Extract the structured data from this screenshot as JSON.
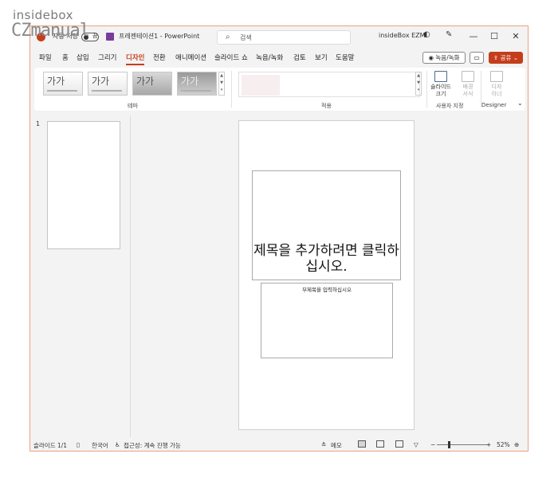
{
  "watermark": {
    "line1": "insidebox",
    "line2": "CZmanual"
  },
  "titlebar": {
    "autosave_label": "자동 저장",
    "autosave_state": "끔",
    "doc_title": "프레젠테이션1 - PowerPoint",
    "search_placeholder": "검색",
    "user_name": "insideBox EZM",
    "min": "—",
    "max": "☐",
    "close": "✕"
  },
  "menu": {
    "items": [
      "파일",
      "홈",
      "삽입",
      "그리기",
      "디자인",
      "전환",
      "애니메이션",
      "슬라이드 쇼",
      "녹음/녹화",
      "검토",
      "보기",
      "도움말"
    ],
    "active": "디자인",
    "record_button": "◉ 녹음/녹화",
    "share_button": "공유"
  },
  "ribbon": {
    "themes": [
      "가가",
      "가가",
      "가가",
      "가가"
    ],
    "groups": {
      "theme": "테마",
      "variants": "적용",
      "customize": "사용자 지정",
      "designer": "Designer"
    },
    "commands": {
      "slide_size": [
        "슬라이드",
        "크기"
      ],
      "bg_format": [
        "배경",
        "서식"
      ],
      "designer": [
        "디자",
        "이너"
      ]
    }
  },
  "thumbs": {
    "number": "1"
  },
  "slide": {
    "title_placeholder": "제목을 추가하려면 클릭하십시오.",
    "subtitle_placeholder": "부제목을 입력하십시오"
  },
  "status": {
    "slide_count": "슬라이드 1/1",
    "language": "한국어",
    "accessibility": "접근성: 계속 진행 가능",
    "notes": "메모",
    "zoom": "52%"
  },
  "colors": {
    "accent": "#c43e1c",
    "window_border": "#f0a080"
  }
}
